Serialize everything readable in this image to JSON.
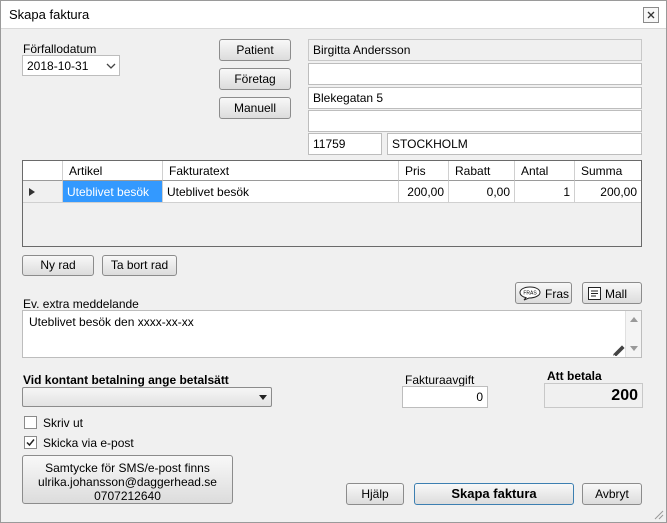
{
  "window": {
    "title": "Skapa faktura"
  },
  "due_date": {
    "label": "Förfallodatum",
    "value": "2018-10-31"
  },
  "recipient_buttons": {
    "patient": "Patient",
    "company": "Företag",
    "manual": "Manuell"
  },
  "address": {
    "name": "Birgitta Andersson",
    "line2": "",
    "street": "Blekegatan 5",
    "line4": "",
    "zip": "11759",
    "city": "STOCKHOLM"
  },
  "table": {
    "headers": [
      "Artikel",
      "Fakturatext",
      "Pris",
      "Rabatt",
      "Antal",
      "Summa"
    ],
    "rows": [
      {
        "artikel": "Uteblivet besök",
        "fakturatext": "Uteblivet besök",
        "pris": "200,00",
        "rabatt": "0,00",
        "antal": "1",
        "summa": "200,00"
      }
    ]
  },
  "row_buttons": {
    "new": "Ny rad",
    "remove": "Ta bort rad"
  },
  "message": {
    "label": "Ev. extra meddelande",
    "value": "Uteblivet besök den xxxx-xx-xx",
    "fras_label": "Fras",
    "mall_label": "Mall",
    "fras_icon": "FRAS"
  },
  "payment": {
    "label": "Vid kontant betalning ange betalsätt",
    "value": ""
  },
  "invoice_fee": {
    "label": "Fakturaavgift",
    "value": "0"
  },
  "total": {
    "label": "Att betala",
    "value": "200"
  },
  "options": {
    "print_label": "Skriv ut",
    "print_checked": false,
    "email_label": "Skicka via e-post",
    "email_checked": true
  },
  "consent": {
    "line1": "Samtycke för SMS/e-post finns",
    "line2": "ulrika.johansson@daggerhead.se",
    "line3": "0707212640"
  },
  "footer": {
    "help": "Hjälp",
    "create": "Skapa faktura",
    "cancel": "Avbryt"
  }
}
